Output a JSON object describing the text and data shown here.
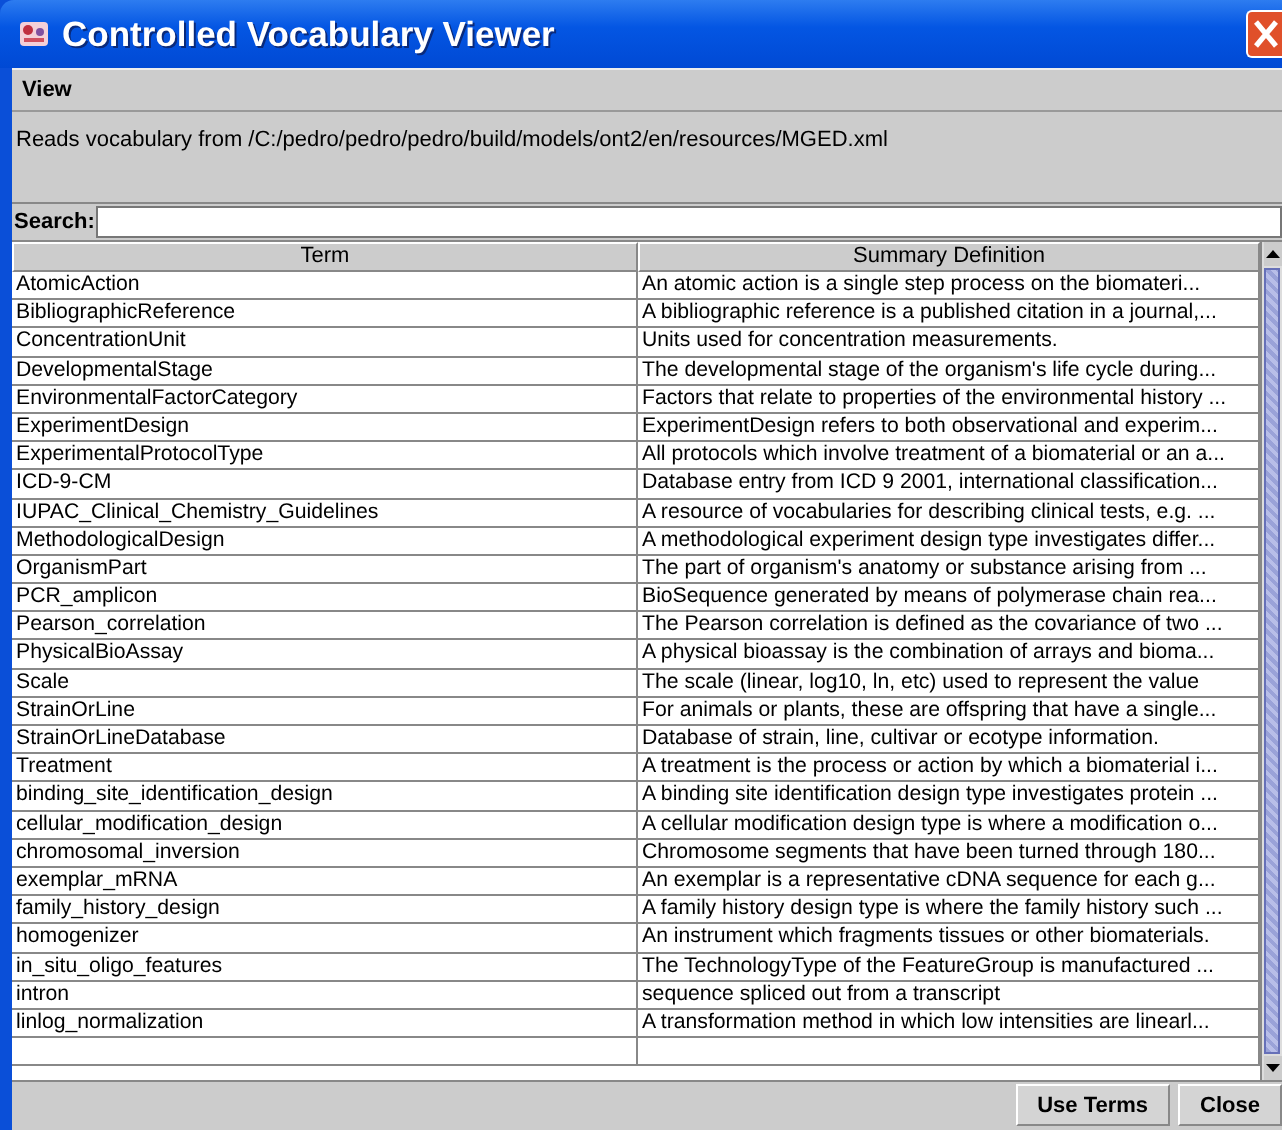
{
  "window": {
    "title": "Controlled Vocabulary Viewer"
  },
  "menu": [
    "View"
  ],
  "info": "Reads vocabulary from /C:/pedro/pedro/pedro/build/models/ont2/en/resources/MGED.xml",
  "search": {
    "label": "Search:"
  },
  "table": {
    "columns": [
      "Term",
      "Summary Definition"
    ],
    "rows": [
      [
        "AtomicAction",
        "An atomic action  is a single step process on the biomateri..."
      ],
      [
        "BibliographicReference",
        "A bibliographic reference is a published citation in a journal,..."
      ],
      [
        "ConcentrationUnit",
        "Units used for concentration measurements."
      ],
      [
        "DevelopmentalStage",
        "The developmental stage of the organism's life cycle during..."
      ],
      [
        "EnvironmentalFactorCategory",
        "Factors that relate to properties of the environmental history ..."
      ],
      [
        "ExperimentDesign",
        "ExperimentDesign refers to both observational and experim..."
      ],
      [
        "ExperimentalProtocolType",
        "All protocols which involve treatment of a biomaterial or an a..."
      ],
      [
        "ICD-9-CM",
        "Database entry from ICD 9 2001, international classification..."
      ],
      [
        "IUPAC_Clinical_Chemistry_Guidelines",
        "A resource of vocabularies for describing clinical tests, e.g. ..."
      ],
      [
        "MethodologicalDesign",
        "A methodological experiment design type investigates differ..."
      ],
      [
        "OrganismPart",
        "The part of organism's anatomy or substance arising from ..."
      ],
      [
        "PCR_amplicon",
        "BioSequence generated by means of polymerase chain rea..."
      ],
      [
        "Pearson_correlation",
        "The Pearson correlation is defined as the covariance of two ..."
      ],
      [
        "PhysicalBioAssay",
        "A physical bioassay is the combination of arrays and bioma..."
      ],
      [
        "Scale",
        "The scale (linear, log10, ln, etc) used to represent the value"
      ],
      [
        "StrainOrLine",
        "For animals or plants, these are offspring that have a single..."
      ],
      [
        "StrainOrLineDatabase",
        "Database of strain, line, cultivar or ecotype information."
      ],
      [
        "Treatment",
        "A treatment is the process or action by which a biomaterial i..."
      ],
      [
        "binding_site_identification_design",
        "A binding site identification design type investigates protein ..."
      ],
      [
        "cellular_modification_design",
        "A cellular modification design type is where a modification o..."
      ],
      [
        "chromosomal_inversion",
        "Chromosome segments that have been turned through 180..."
      ],
      [
        "exemplar_mRNA",
        "An exemplar is a representative cDNA sequence for each g..."
      ],
      [
        "family_history_design",
        "A family history design type is where the family history such ..."
      ],
      [
        "homogenizer",
        "An instrument which fragments tissues or other biomaterials."
      ],
      [
        "in_situ_oligo_features",
        "The TechnologyType of the FeatureGroup  is manufactured ..."
      ],
      [
        "intron",
        "sequence spliced out from a transcript"
      ],
      [
        "linlog_normalization",
        "A transformation method in which low intensities are linearl..."
      ]
    ]
  },
  "buttons": [
    "Use Terms",
    "Close"
  ]
}
